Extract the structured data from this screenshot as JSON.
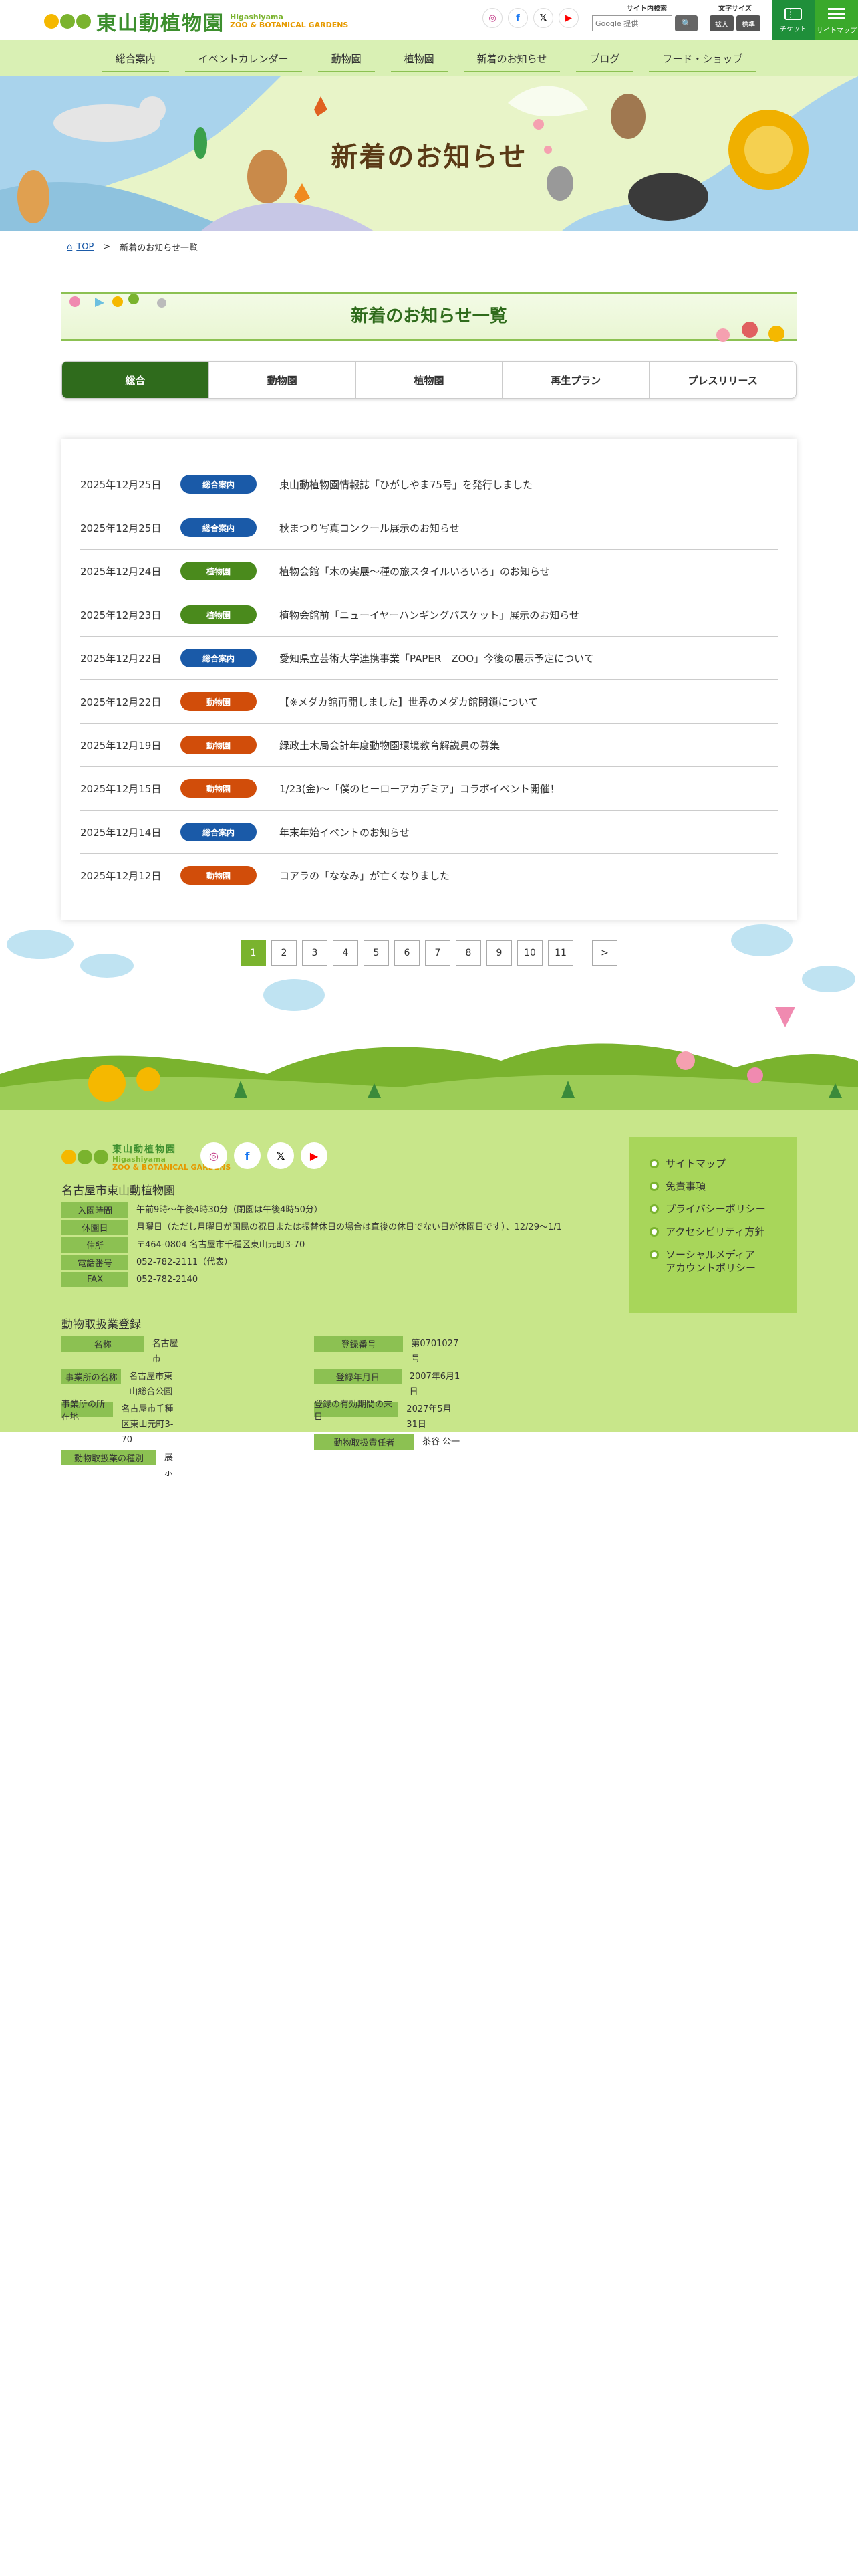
{
  "header": {
    "logo_ja": "東山動植物園",
    "logo_en_1": "Higashiyama",
    "logo_en_2": "ZOO & BOTANICAL GARDENS",
    "sns": [
      {
        "name": "instagram-icon",
        "glyph": "◎",
        "color": "#c13584"
      },
      {
        "name": "facebook-icon",
        "glyph": "f",
        "color": "#1877f2"
      },
      {
        "name": "x-icon",
        "glyph": "𝕏",
        "color": "#000000"
      },
      {
        "name": "youtube-icon",
        "glyph": "▶",
        "color": "#ff0000"
      }
    ],
    "search_label": "サイト内検索",
    "search_placeholder": "Google 提供",
    "search_button": "🔍",
    "font_size_label": "文字サイズ",
    "font_size_large": "拡大",
    "font_size_normal": "標準",
    "ticket_label": "チケット",
    "sitemap_label": "サイトマップ"
  },
  "nav": [
    "総合案内",
    "イベントカレンダー",
    "動物園",
    "植物園",
    "新着のお知らせ",
    "ブログ",
    "フード・ショップ"
  ],
  "hero": {
    "title": "新着のお知らせ"
  },
  "breadcrumb": {
    "home": "TOP",
    "separator": ">",
    "current": "新着のお知らせ一覧"
  },
  "section": {
    "title": "新着のお知らせ一覧"
  },
  "tabs": [
    "総合",
    "動物園",
    "植物園",
    "再生プラン",
    "プレスリリース"
  ],
  "category_colors": {
    "総合案内": "#1a5aa8",
    "植物園": "#4a8a1c",
    "動物園": "#d14d0a"
  },
  "news": [
    {
      "date": "2025年12月25日",
      "category": "総合案内",
      "title": "東山動植物園情報誌「ひがしやま75号」を発行しました"
    },
    {
      "date": "2025年12月25日",
      "category": "総合案内",
      "title": "秋まつり写真コンクール展示のお知らせ"
    },
    {
      "date": "2025年12月24日",
      "category": "植物園",
      "title": "植物会館「木の実展～種の旅スタイルいろいろ」のお知らせ"
    },
    {
      "date": "2025年12月23日",
      "category": "植物園",
      "title": "植物会館前「ニューイヤーハンギングバスケット」展示のお知らせ"
    },
    {
      "date": "2025年12月22日",
      "category": "総合案内",
      "title": "愛知県立芸術大学連携事業「PAPER　ZOO」今後の展示予定について"
    },
    {
      "date": "2025年12月22日",
      "category": "動物園",
      "title": "【※メダカ館再開しました】世界のメダカ館閉鎖について"
    },
    {
      "date": "2025年12月19日",
      "category": "動物園",
      "title": "緑政土木局会計年度動物園環境教育解説員の募集"
    },
    {
      "date": "2025年12月15日",
      "category": "動物園",
      "title": "1/23(金)～「僕のヒーローアカデミア」コラボイベント開催！"
    },
    {
      "date": "2025年12月14日",
      "category": "総合案内",
      "title": "年末年始イベントのお知らせ"
    },
    {
      "date": "2025年12月12日",
      "category": "動物園",
      "title": "コアラの「ななみ」が亡くなりました"
    }
  ],
  "pagination": {
    "pages": [
      "1",
      "2",
      "3",
      "4",
      "5",
      "6",
      "7",
      "8",
      "9",
      "10",
      "11"
    ],
    "current": "1",
    "next": ">"
  },
  "footer": {
    "name": "名古屋市東山動植物園",
    "info": [
      {
        "label": "入園時間",
        "value": "午前9時～午後4時30分（閉園は午後4時50分）"
      },
      {
        "label": "休園日",
        "value": "月曜日（ただし月曜日が国民の祝日または振替休日の場合は直後の休日でない日が休園日です）、12/29～1/1"
      },
      {
        "label": "住所",
        "value": "〒464-0804 名古屋市千種区東山元町3-70"
      },
      {
        "label": "電話番号",
        "value": "052-782-2111（代表）"
      },
      {
        "label": "FAX",
        "value": "052-782-2140"
      }
    ],
    "registration_title": "動物取扱業登録",
    "registration_left": [
      {
        "label": "名称",
        "value": "名古屋市"
      },
      {
        "label": "事業所の名称",
        "value": "名古屋市東山総合公園"
      },
      {
        "label": "事業所の所在地",
        "value": "名古屋市千種区東山元町3-70"
      },
      {
        "label": "動物取扱業の種別",
        "value": "展示"
      }
    ],
    "registration_right": [
      {
        "label": "登録番号",
        "value": "第0701027号"
      },
      {
        "label": "登録年月日",
        "value": "2007年6月1日"
      },
      {
        "label": "登録の有効期間の末日",
        "value": "2027年5月31日"
      },
      {
        "label": "動物取扱責任者",
        "value": "茶谷 公一"
      }
    ],
    "links": [
      "サイトマップ",
      "免責事項",
      "プライバシーポリシー",
      "アクセシビリティ方針",
      "ソーシャルメディア\nアカウントポリシー"
    ]
  }
}
